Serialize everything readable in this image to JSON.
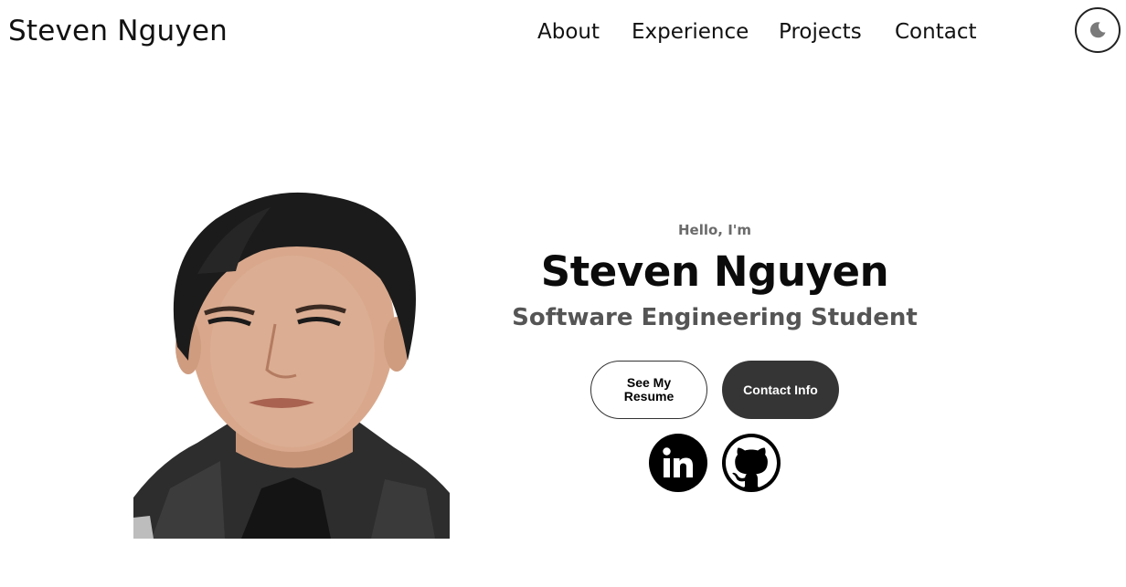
{
  "header": {
    "logo_text": "Steven Nguyen",
    "nav": [
      {
        "label": "About"
      },
      {
        "label": "Experience"
      },
      {
        "label": "Projects"
      },
      {
        "label": "Contact"
      }
    ],
    "theme_toggle_icon": "moon-icon"
  },
  "hero": {
    "photo": "profile-photo",
    "greeting": "Hello, I'm",
    "name": "Steven Nguyen",
    "role": "Software Engineering Student",
    "buttons": {
      "resume_label": "See My Resume",
      "contact_label": "Contact Info"
    },
    "socials": [
      {
        "icon": "linkedin-icon"
      },
      {
        "icon": "github-icon"
      }
    ]
  },
  "colors": {
    "background": "#ffffff",
    "text": "#111111",
    "muted": "#555555",
    "greeting": "#6b6b6b",
    "button_dark": "#353535",
    "icon": "#000000"
  }
}
